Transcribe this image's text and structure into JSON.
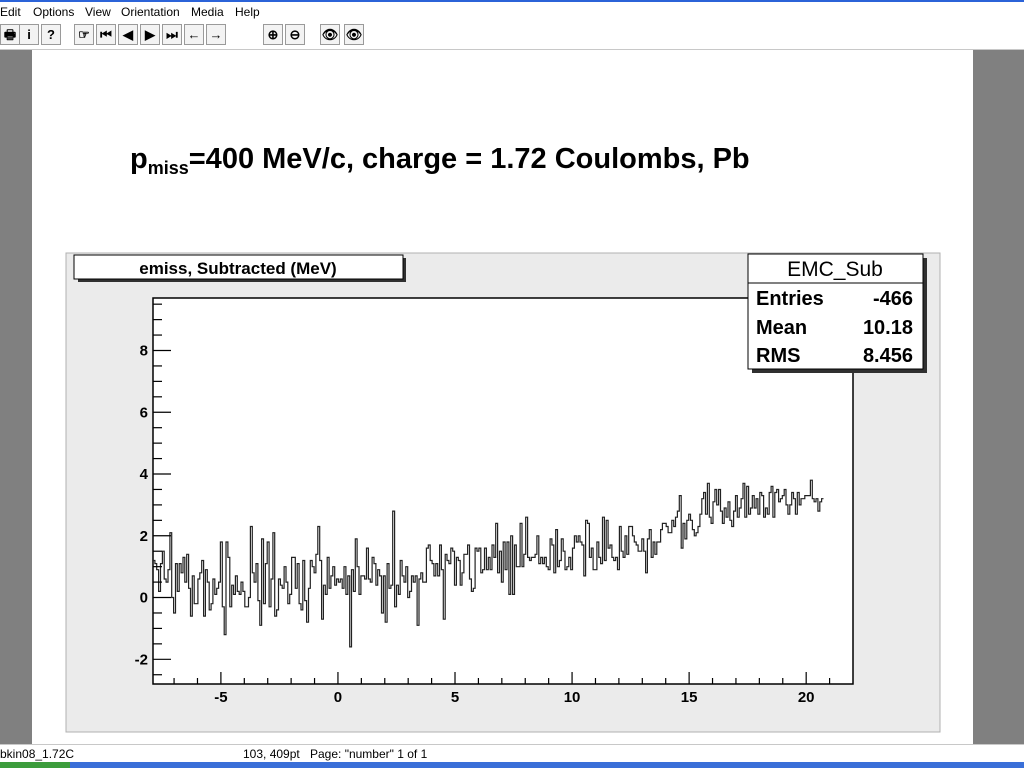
{
  "menu": [
    "Edit",
    "Options",
    "View",
    "Orientation",
    "Media",
    "Help"
  ],
  "toolbar": {
    "buttons": [
      {
        "name": "print-icon",
        "glyph": "🖶"
      },
      {
        "name": "info-icon",
        "glyph": "i"
      },
      {
        "name": "help-icon",
        "glyph": "?"
      },
      {
        "name": "hand-icon",
        "glyph": "☞"
      },
      {
        "name": "first-page-icon",
        "glyph": "⏮"
      },
      {
        "name": "prev-page-icon",
        "glyph": "◀"
      },
      {
        "name": "next-page-icon",
        "glyph": "▶"
      },
      {
        "name": "last-page-icon",
        "glyph": "⏭"
      },
      {
        "name": "back-icon",
        "glyph": "←"
      },
      {
        "name": "forward-icon",
        "glyph": "→"
      },
      {
        "name": "zoom-in-icon",
        "glyph": "⊕"
      },
      {
        "name": "zoom-out-icon",
        "glyph": "⊖"
      },
      {
        "name": "show-icon",
        "glyph": "👁"
      },
      {
        "name": "show-all-icon",
        "glyph": "👁"
      }
    ]
  },
  "page": {
    "title_prefix": "p",
    "title_sub": "miss",
    "title_rest": "=400 MeV/c, charge = 1.72 Coulombs, Pb"
  },
  "status": {
    "file": "bkin08_1.72C",
    "coords": "103, 409pt",
    "page": "Page: \"number\"  1 of 1"
  },
  "chart_data": {
    "type": "bar",
    "title": "emiss, Subtracted (MeV)",
    "xlim": [
      -7.9,
      22
    ],
    "ylim": [
      -2.8,
      9.7
    ],
    "xticks": [
      -5,
      0,
      5,
      10,
      15,
      20
    ],
    "yticks": [
      -2,
      0,
      2,
      4,
      6,
      8
    ],
    "grid": false,
    "stats": {
      "name": "EMC_Sub",
      "rows": [
        {
          "label": "Entries",
          "value": "-466"
        },
        {
          "label": "Mean",
          "value": "10.18"
        },
        {
          "label": "RMS",
          "value": "8.456"
        }
      ]
    },
    "bin_width": 0.08,
    "x_start": -7.9,
    "values": [
      1.2,
      1.1,
      0.9,
      0.2,
      1.1,
      1.5,
      0.6,
      0.5,
      0.9,
      2.1,
      0.0,
      -0.5,
      1.1,
      0.2,
      1.1,
      0.8,
      1.3,
      0.5,
      1.4,
      0.3,
      -0.6,
      0.7,
      -0.2,
      -0.2,
      0.6,
      0.8,
      1.2,
      -0.6,
      0.9,
      0.5,
      -0.4,
      -0.2,
      0.6,
      0.1,
      0.3,
      0.5,
      1.8,
      -0.3,
      -1.2,
      1.8,
      1.3,
      -0.3,
      0.4,
      0.1,
      0.7,
      0.2,
      0.1,
      0.5,
      0.2,
      -0.3,
      -0.3,
      0.0,
      2.3,
      0.8,
      0.5,
      1.1,
      -0.1,
      -0.9,
      1.9,
      -0.2,
      1.1,
      1.8,
      -0.3,
      0.6,
      2.1,
      -0.6,
      -0.4,
      0.6,
      0.4,
      0.3,
      1.0,
      0.5,
      -0.2,
      0.1,
      1.3,
      1.3,
      0.3,
      1.1,
      -0.2,
      -0.4,
      1.2,
      -0.1,
      -0.8,
      0.3,
      1.2,
      1.0,
      0.8,
      1.4,
      2.3,
      1.2,
      -0.7,
      0.4,
      0.1,
      1.3,
      0.3,
      0.7,
      1.0,
      0.4,
      0.6,
      0.5,
      0.6,
      0.3,
      1.0,
      0.1,
      0.7,
      -1.6,
      0.9,
      0.2,
      1.9,
      1.0,
      0.1,
      0.7,
      0.7,
      0.6,
      1.6,
      0.6,
      0.5,
      1.3,
      1.1,
      0.4,
      0.9,
      0.7,
      -0.5,
      0.7,
      -0.8,
      1.1,
      0.3,
      0.4,
      2.8,
      -0.3,
      0.4,
      0.1,
      1.2,
      0.7,
      0.5,
      1.0,
      0.0,
      0.2,
      0.7,
      0.5,
      0.7,
      -0.9,
      0.6,
      0.8,
      0.5,
      0.5,
      1.6,
      1.7,
      1.2,
      1.1,
      0.7,
      1.1,
      0.7,
      1.7,
      0.9,
      -0.7,
      1.4,
      1.2,
      1.1,
      1.6,
      1.5,
      0.4,
      1.3,
      1.2,
      0.4,
      0.8,
      1.4,
      1.4,
      1.7,
      0.6,
      0.2,
      0.3,
      1.6,
      1.5,
      1.6,
      0.8,
      0.9,
      1.6,
      0.9,
      1.3,
      0.9,
      1.7,
      1.3,
      2.4,
      0.8,
      1.5,
      0.5,
      1.8,
      0.9,
      1.8,
      0.1,
      2.0,
      0.1,
      1.7,
      1.0,
      1.0,
      2.4,
      1.0,
      1.4,
      2.6,
      1.3,
      1.2,
      1.3,
      1.3,
      1.4,
      2.0,
      1.1,
      1.3,
      1.1,
      1.3,
      1.0,
      0.9,
      1.9,
      1.7,
      0.8,
      2.2,
      1.0,
      1.2,
      1.9,
      1.5,
      0.9,
      1.0,
      1.3,
      0.9,
      1.6,
      2.0,
      1.8,
      2.0,
      1.8,
      1.7,
      0.7,
      2.5,
      2.4,
      1.3,
      1.6,
      0.9,
      0.9,
      1.8,
      1.3,
      1.1,
      2.6,
      1.2,
      2.5,
      1.6,
      1.7,
      1.3,
      1.2,
      1.3,
      0.9,
      2.3,
      1.5,
      1.3,
      2.0,
      1.4,
      2.3,
      2.3,
      2.0,
      1.8,
      1.7,
      1.5,
      1.5,
      1.9,
      1.5,
      0.8,
      1.9,
      2.2,
      1.3,
      1.8,
      1.4,
      1.8,
      1.8,
      2.2,
      2.4,
      2.4,
      2.3,
      2.1,
      2.1,
      2.5,
      2.3,
      2.6,
      2.8,
      3.3,
      1.6,
      2.4,
      1.9,
      2.5,
      2.7,
      2.5,
      2.2,
      2.0,
      2.1,
      2.3,
      2.7,
      3.2,
      3.4,
      2.7,
      3.7,
      2.6,
      2.4,
      3.1,
      3.5,
      3.0,
      3.5,
      2.8,
      2.4,
      2.9,
      2.6,
      3.1,
      2.5,
      2.3,
      2.8,
      3.3,
      2.6,
      2.9,
      3.2,
      3.7,
      2.6,
      3.6,
      2.7,
      2.9,
      3.3,
      2.9,
      3.2,
      2.7,
      3.4,
      3.3,
      2.6,
      2.9,
      2.7,
      3.4,
      3.6,
      2.6,
      3.4,
      3.5,
      3.1,
      3.2,
      3.3,
      3.5,
      3.0,
      2.7,
      3.0,
      3.4,
      3.2,
      2.7,
      3.4,
      3.0,
      3.2,
      3.2,
      3.3,
      3.3,
      3.3,
      3.8,
      3.2,
      3.1,
      3.2,
      2.8,
      3.1,
      3.2
    ]
  }
}
